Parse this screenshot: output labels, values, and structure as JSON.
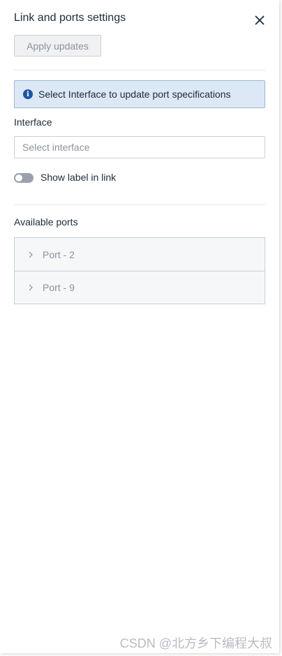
{
  "panel": {
    "title": "Link and ports settings",
    "close_icon": "close-icon",
    "apply_button_label": "Apply updates"
  },
  "info": {
    "icon": "info-icon",
    "icon_glyph": "i",
    "text": "Select Interface to update port specifications"
  },
  "interface": {
    "label": "Interface",
    "placeholder": "Select interface",
    "value": ""
  },
  "toggle": {
    "label": "Show label in link",
    "checked": false
  },
  "ports": {
    "heading": "Available ports",
    "items": [
      {
        "label": "Port - 2",
        "expanded": false
      },
      {
        "label": "Port - 9",
        "expanded": false
      }
    ]
  },
  "watermark": "CSDN @北方乡下编程大叔",
  "colors": {
    "info_bg": "#dce8f5",
    "info_border": "#9cb6d3",
    "info_icon": "#1c55a3",
    "disabled_text": "#8b929c",
    "toggle_off": "#9aa1ab"
  }
}
